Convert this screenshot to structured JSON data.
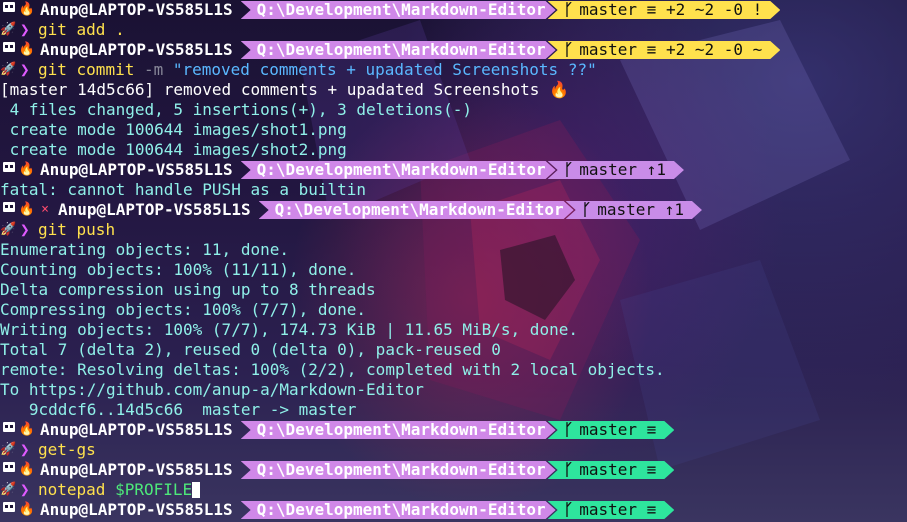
{
  "prompt": {
    "user": "Anup@LAPTOP-VS585L1S",
    "path": "Q:\\Development\\Markdown-Editor"
  },
  "lines": [
    {
      "kind": "prompt",
      "git": "master ≡ +2 ~2 -0 !",
      "git_color": "yellow"
    },
    {
      "kind": "command",
      "parts": [
        {
          "t": "git",
          "c": "cmd"
        },
        {
          "t": " add .",
          "c": "arg"
        }
      ]
    },
    {
      "kind": "prompt",
      "git": "master ≡ +2 ~2 -0 ~",
      "git_color": "yellow"
    },
    {
      "kind": "command",
      "parts": [
        {
          "t": "git",
          "c": "cmd"
        },
        {
          "t": " commit ",
          "c": "arg"
        },
        {
          "t": "-m",
          "c": "flag"
        },
        {
          "t": " \"removed comments + upadated Screenshots ??\"",
          "c": "str"
        }
      ]
    },
    {
      "kind": "output",
      "text": "[master 14d5c66] removed comments + upadated Screenshots 🔥",
      "style": "out"
    },
    {
      "kind": "output",
      "text": " 4 files changed, 5 insertions(+), 3 deletions(-)",
      "style": "out-cyan"
    },
    {
      "kind": "output",
      "text": " create mode 100644 images/shot1.png",
      "style": "out-cyan"
    },
    {
      "kind": "output",
      "text": " create mode 100644 images/shot2.png",
      "style": "out-cyan"
    },
    {
      "kind": "prompt",
      "git": "master ↑1",
      "git_color": "purple"
    },
    {
      "kind": "output",
      "text": "fatal: cannot handle PUSH as a builtin",
      "style": "out-cyan"
    },
    {
      "kind": "prompt",
      "git": "master ↑1",
      "git_color": "purple",
      "error": true
    },
    {
      "kind": "command",
      "parts": [
        {
          "t": "git",
          "c": "cmd"
        },
        {
          "t": " push",
          "c": "arg"
        }
      ]
    },
    {
      "kind": "output",
      "text": "Enumerating objects: 11, done.",
      "style": "out-cyan"
    },
    {
      "kind": "output",
      "text": "Counting objects: 100% (11/11), done.",
      "style": "out-cyan"
    },
    {
      "kind": "output",
      "text": "Delta compression using up to 8 threads",
      "style": "out-cyan"
    },
    {
      "kind": "output",
      "text": "Compressing objects: 100% (7/7), done.",
      "style": "out-cyan"
    },
    {
      "kind": "output",
      "text": "Writing objects: 100% (7/7), 174.73 KiB | 11.65 MiB/s, done.",
      "style": "out-cyan"
    },
    {
      "kind": "output",
      "text": "Total 7 (delta 2), reused 0 (delta 0), pack-reused 0",
      "style": "out-cyan"
    },
    {
      "kind": "output",
      "text": "remote: Resolving deltas: 100% (2/2), completed with 2 local objects.",
      "style": "out-cyan"
    },
    {
      "kind": "output",
      "text": "To https://github.com/anup-a/Markdown-Editor",
      "style": "out-cyan"
    },
    {
      "kind": "output",
      "text": "   9cddcf6..14d5c66  master -> master",
      "style": "out-cyan"
    },
    {
      "kind": "prompt",
      "git": "master ≡",
      "git_color": "green"
    },
    {
      "kind": "command",
      "parts": [
        {
          "t": "get-gs",
          "c": "cmd"
        }
      ]
    },
    {
      "kind": "prompt",
      "git": "master ≡",
      "git_color": "green"
    },
    {
      "kind": "command",
      "parts": [
        {
          "t": "notepad",
          "c": "cmd"
        },
        {
          "t": " $PROFILE",
          "c": "var"
        }
      ],
      "cursor": true
    },
    {
      "kind": "prompt",
      "git": "master ≡",
      "git_color": "green"
    }
  ],
  "colors": {
    "path_segment": "#d088e8",
    "git_yellow": "#ffe14d",
    "git_purple": "#c98ce8",
    "git_green": "#2ee59d",
    "chevron": "#e05aff"
  },
  "icons": {
    "prompt_first": "icon-glyph",
    "prompt_second": "fire-icon",
    "error": "error-x-icon",
    "command_prefix": "rocket-icon",
    "git_branch": "git-branch-icon"
  }
}
